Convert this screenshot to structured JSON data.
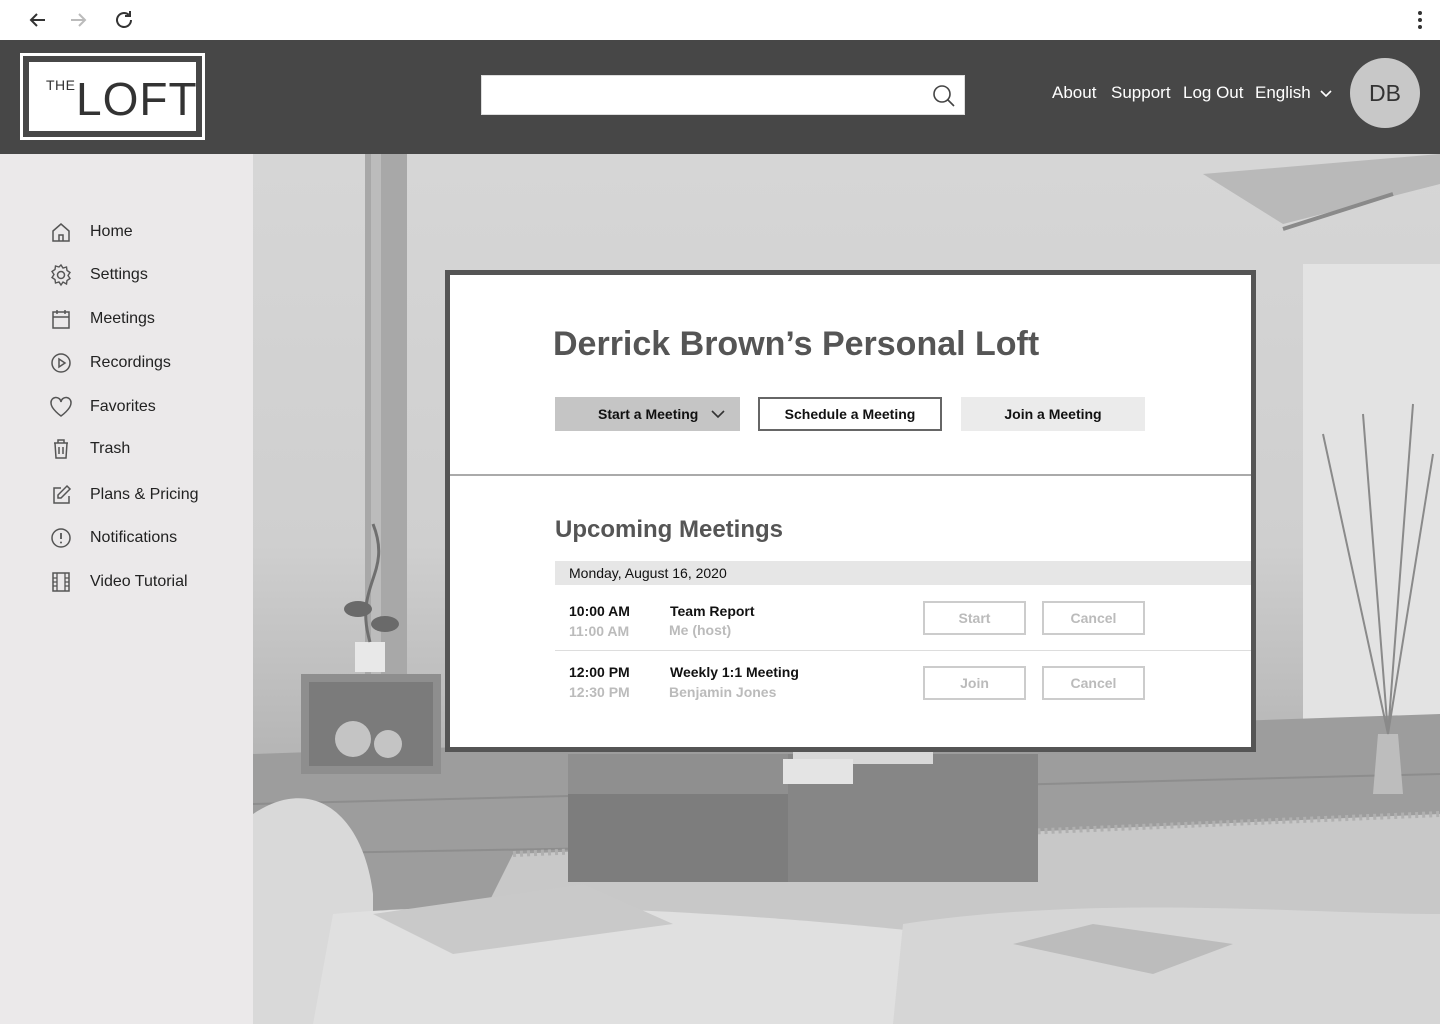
{
  "brand": {
    "logo_the": "THE",
    "logo_word": "LOFT"
  },
  "search": {
    "placeholder": "",
    "value": ""
  },
  "topnav": {
    "about": "About",
    "support": "Support",
    "logout": "Log Out",
    "language": "English"
  },
  "user": {
    "initials": "DB"
  },
  "sidebar": {
    "items": [
      {
        "label": "Home",
        "icon": "home-icon"
      },
      {
        "label": "Settings",
        "icon": "gear-icon"
      },
      {
        "label": "Meetings",
        "icon": "calendar-icon"
      },
      {
        "label": "Recordings",
        "icon": "play-circle-icon"
      },
      {
        "label": "Favorites",
        "icon": "heart-icon"
      },
      {
        "label": "Trash",
        "icon": "trash-icon"
      },
      {
        "label": "Plans & Pricing",
        "icon": "edit-icon"
      },
      {
        "label": "Notifications",
        "icon": "alert-circle-icon"
      },
      {
        "label": "Video Tutorial",
        "icon": "film-icon"
      }
    ]
  },
  "main": {
    "title": "Derrick Brown’s Personal Loft",
    "actions": {
      "start": "Start a Meeting",
      "schedule": "Schedule a Meeting",
      "join": "Join a Meeting"
    },
    "upcoming": {
      "heading": "Upcoming Meetings",
      "date": "Monday, August 16, 2020",
      "meetings": [
        {
          "start": "10:00 AM",
          "end": "11:00 AM",
          "name": "Team Report",
          "host": "Me (host)",
          "primary_action": "Start",
          "secondary_action": "Cancel"
        },
        {
          "start": "12:00 PM",
          "end": "12:30 PM",
          "name": "Weekly 1:1 Meeting",
          "host": "Benjamin Jones",
          "primary_action": "Join",
          "secondary_action": "Cancel"
        }
      ]
    }
  },
  "colors": {
    "header": "#474747",
    "sidebar": "#ebe9ea",
    "card_border": "#555555",
    "title": "#555555"
  }
}
